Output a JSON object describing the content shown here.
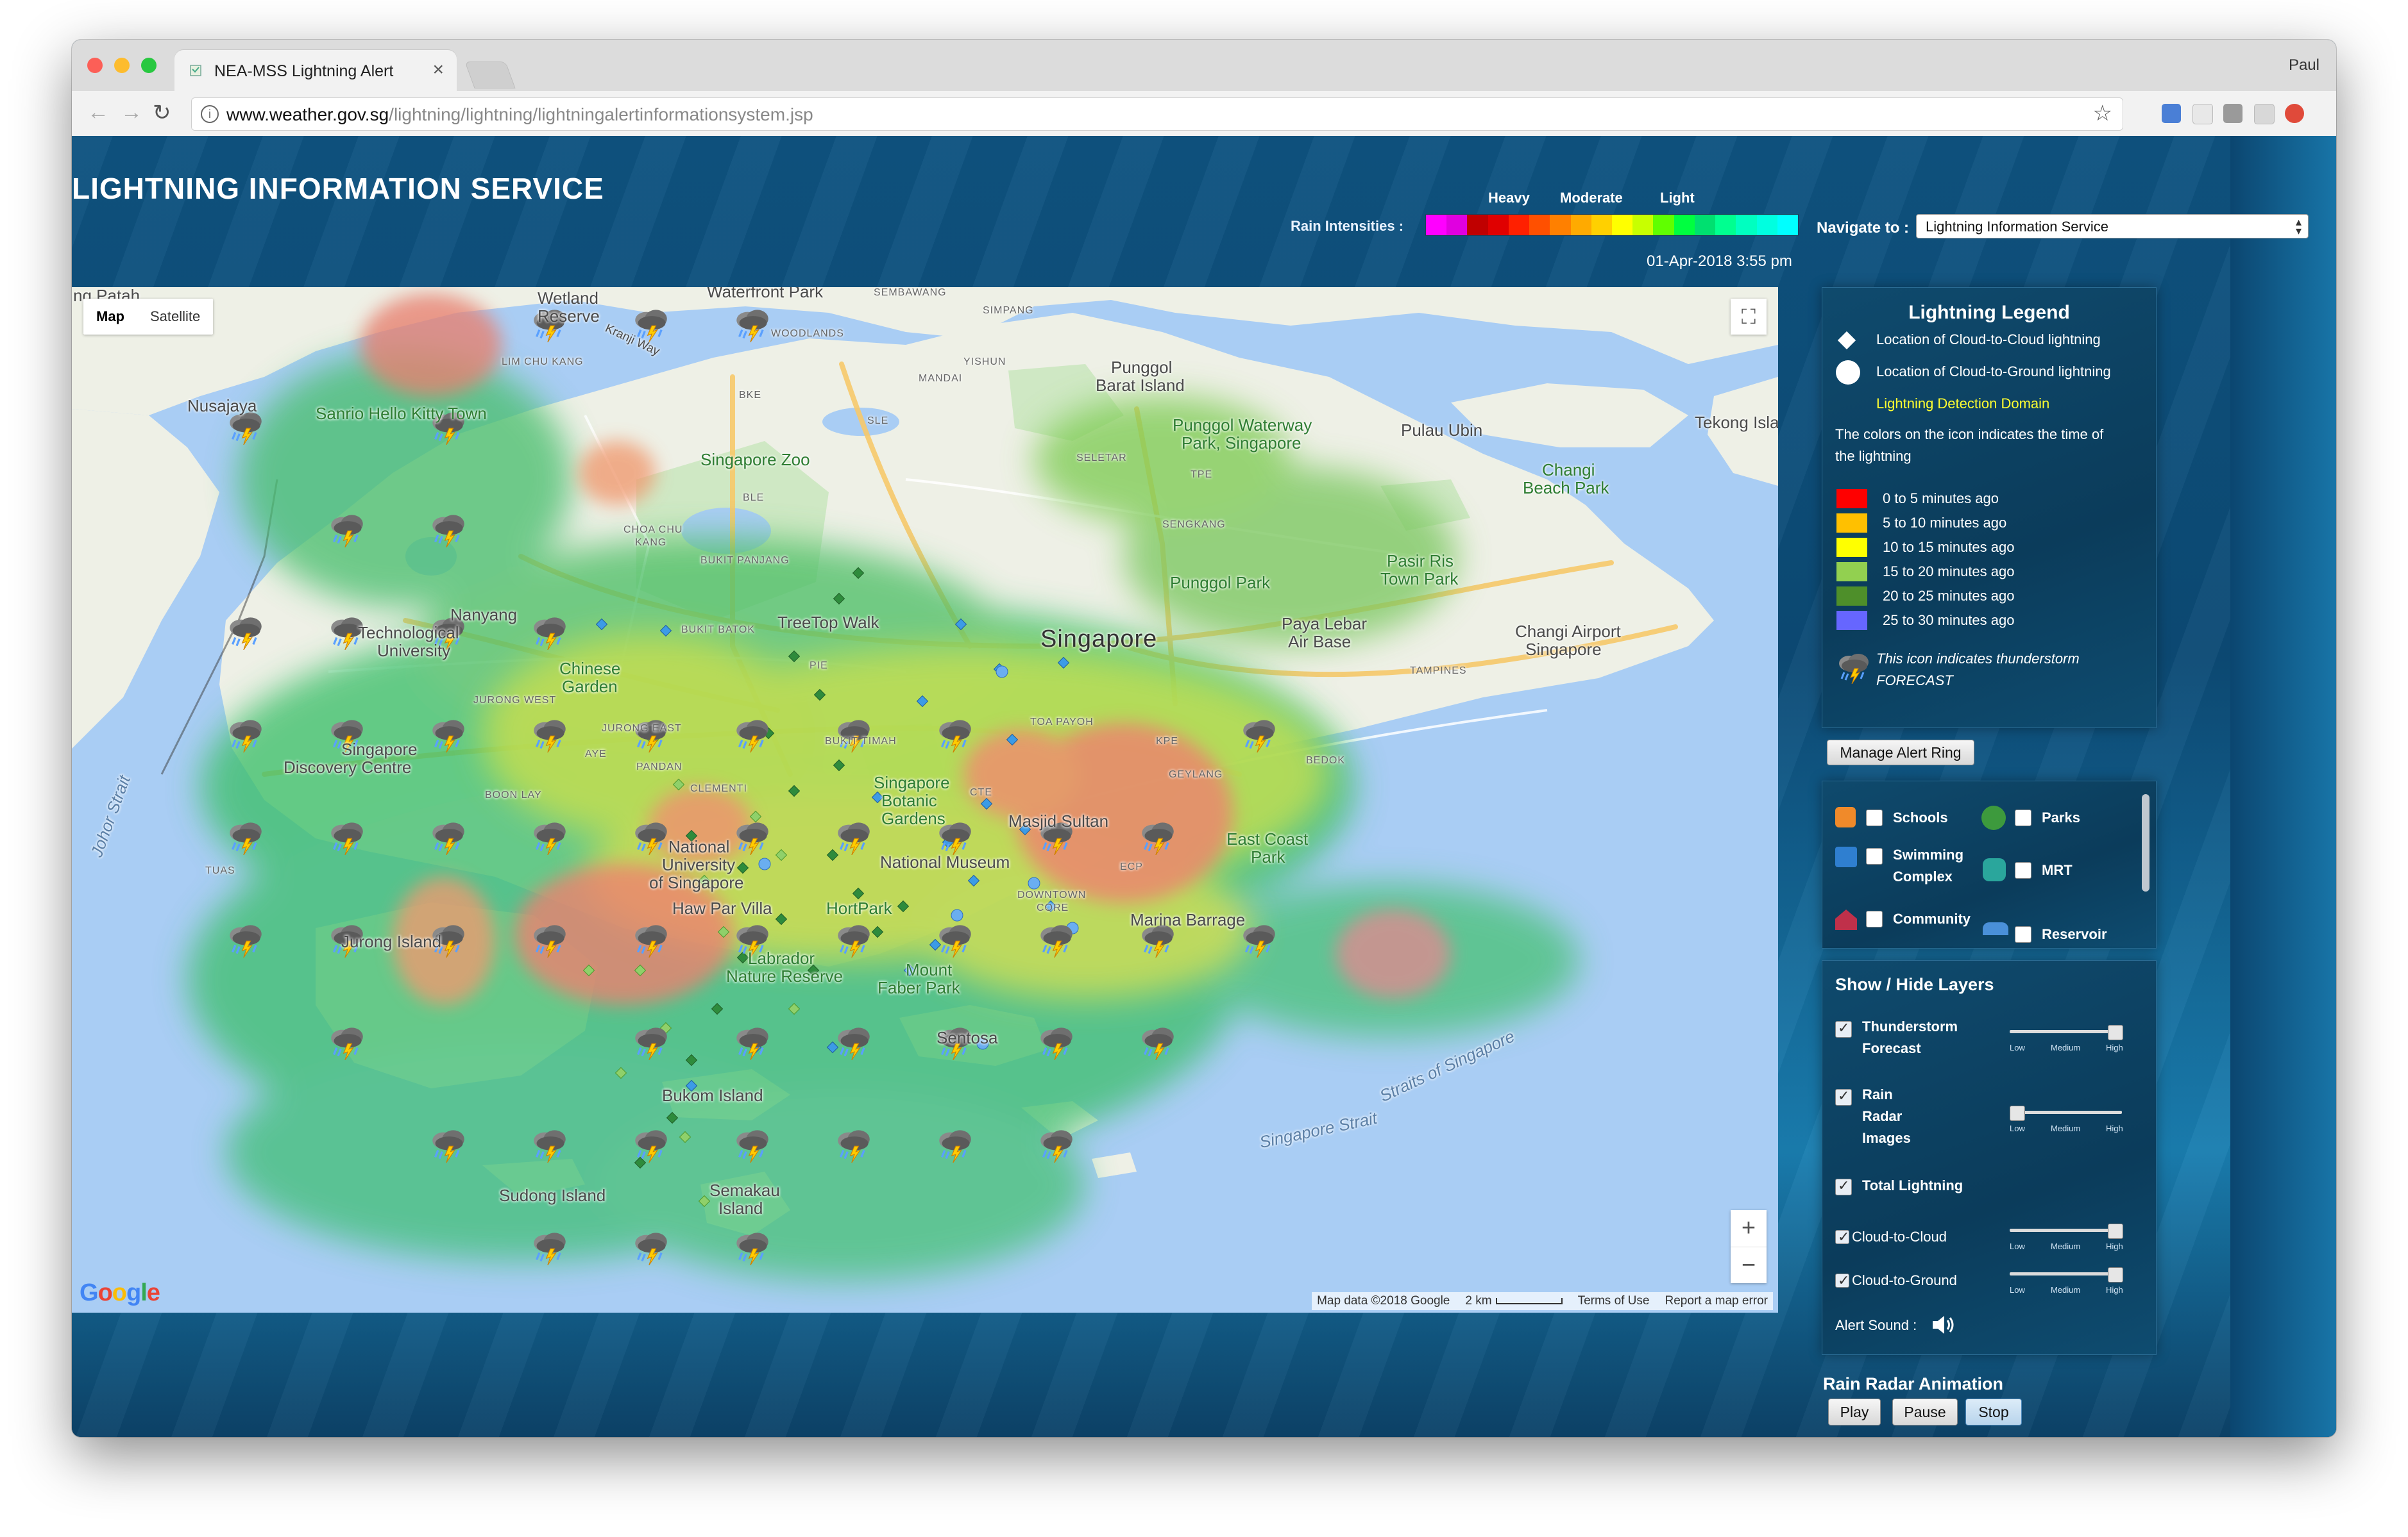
{
  "browser": {
    "tab_title": "NEA-MSS Lightning Alert",
    "tab_close": "×",
    "profile": "Paul",
    "url_host": "www.weather.gov.sg",
    "url_path": "/lightning/lightning/lightningalertinformationsystem.jsp"
  },
  "header": {
    "site_title": "LIGHTNING INFORMATION SERVICE",
    "rain_intensities_label": "Rain Intensities :",
    "intensity_heavy": "Heavy",
    "intensity_moderate": "Moderate",
    "intensity_light": "Light",
    "rain_colors": [
      "#ff00ff",
      "#e000e0",
      "#c00000",
      "#e00000",
      "#ff2000",
      "#ff5000",
      "#ff8000",
      "#ffaa00",
      "#ffd000",
      "#ffff00",
      "#c8ff00",
      "#60ff00",
      "#00ff40",
      "#00e070",
      "#00ff90",
      "#00ffc0",
      "#00ffe0",
      "#00ffff"
    ],
    "navigate_label": "Navigate to :",
    "navigate_selected": "Lightning Information Service",
    "datetime": "01-Apr-2018  3:55 pm"
  },
  "map": {
    "type_map": "Map",
    "type_satellite": "Satellite",
    "zoom_in": "+",
    "zoom_out": "−",
    "attribution": "Map data ©2018 Google",
    "scale": "2 km",
    "terms": "Terms of Use",
    "report": "Report a map error",
    "google": "Google",
    "labels": {
      "singapore": "Singapore",
      "nusajaya": "Nusajaya",
      "wetland": "Wetland",
      "reserve": "Reserve",
      "waterfront_park": "Waterfront Park",
      "kranji_way": "Kranji Way",
      "sembawang": "SEMBAWANG",
      "simpang": "SIMPANG",
      "woodlands": "WOODLANDS",
      "lim_chu_kang": "LIM CHU KANG",
      "yishun": "YISHUN",
      "mandai": "MANDAI",
      "punggol": "Punggol",
      "barat_island": "Barat Island",
      "sanrio": "Sanrio Hello Kitty Town",
      "singapore_zoo": "Singapore Zoo",
      "punggol_waterway": "Punggol Waterway",
      "park_singapore": "Park, Singapore",
      "pulau_ubin": "Pulau Ubin",
      "tekong": "Tekong Isla",
      "changi": "Changi",
      "beach_park": "Beach Park",
      "seletar": "SELETAR",
      "choa_chu": "CHOA CHU",
      "kang": "KANG",
      "bukit_panjang": "BUKIT PANJANG",
      "sengkang": "SENGKANG",
      "pasir_ris": "Pasir Ris",
      "town_park": "Town Park",
      "nanyang": "Nanyang",
      "technological": "Technological",
      "university": "University",
      "bukit_batok": "BUKIT BATOK",
      "treetop_walk": "TreeTop Walk",
      "punggol_park": "Punggol Park",
      "paya_lebar": "Paya Lebar",
      "air_base": "Air Base",
      "changi_airport": "Changi Airport",
      "changi_airport_2": "Singapore",
      "chinese": "Chinese",
      "garden": "Garden",
      "jurong_east": "JURONG EAST",
      "jurong_west": "JURONG WEST",
      "toa_payoh": "TOA PAYOH",
      "tampines": "TAMPINES",
      "singapore_discovery": "Singapore",
      "discovery_centre": "Discovery Centre",
      "bukit_timah": "BUKIT TIMAH",
      "geylang": "GEYLANG",
      "bedok": "BEDOK",
      "boon_lay": "BOON LAY",
      "pandan": "PANDAN",
      "clementi": "CLEMENTI",
      "botanic": "Singapore",
      "botanic_2": "Botanic",
      "botanic_3": "Gardens",
      "sultan": "Masjid Sultan",
      "east_coast": "East Coast",
      "east_coast_park": "Park",
      "tuas": "TUAS",
      "nus": "National",
      "nus_2": "University",
      "nus_3": "of Singapore",
      "national_museum": "National Museum",
      "downtown": "DOWNTOWN",
      "core": "CORE",
      "haw_par": "Haw Par Villa",
      "hort_park": "HortPark",
      "marina": "Marina Barrage",
      "jurong_island": "Jurong Island",
      "labrador": "Labrador",
      "nature_reserve": "Nature Reserve",
      "mount_faber": "Mount",
      "faber_park": "Faber Park",
      "sentosa": "Sentosa",
      "bukom": "Bukom Island",
      "singapore_strait": "Singapore Strait",
      "straits_of_singapore": "Straits of Singapore",
      "sudong": "Sudong Island",
      "semakau": "Semakau",
      "semakau_2": "Island",
      "johor_strait": "Johor Strait",
      "ecp": "ECP",
      "pie": "PIE",
      "aye": "AYE",
      "ble": "BLE",
      "bke": "BKE",
      "sle": "SLE",
      "tpe": "TPE",
      "kpe": "KPE",
      "cte": "CTE"
    }
  },
  "legend": {
    "title": "Lightning Legend",
    "cc": "Location of Cloud-to-Cloud lightning",
    "cg": "Location of Cloud-to-Ground lightning",
    "domain": "Lightning Detection Domain",
    "note1": "The colors on the icon indicates the time of",
    "note2": "the lightning",
    "times": [
      {
        "label": "0 to 5 minutes ago",
        "color": "#ff0000"
      },
      {
        "label": "5 to 10 minutes ago",
        "color": "#ffc000"
      },
      {
        "label": "10 to 15 minutes ago",
        "color": "#ffff00"
      },
      {
        "label": "15 to 20 minutes ago",
        "color": "#92d050"
      },
      {
        "label": "20 to 25 minutes ago",
        "color": "#4e8f2a"
      },
      {
        "label": "25 to 30 minutes ago",
        "color": "#6666ff"
      }
    ],
    "forecast1": "This icon indicates thunderstorm",
    "forecast2": "FORECAST"
  },
  "alert_ring_button": "Manage Alert Ring",
  "places": {
    "schools": "Schools",
    "parks": "Parks",
    "swimming1": "Swimming",
    "swimming2": "Complex",
    "mrt": "MRT",
    "community": "Community",
    "reservoir": "Reservoir"
  },
  "layers": {
    "title": "Show / Hide Layers",
    "thunder1": "Thunderstorm",
    "thunder2": "Forecast",
    "rain1": "Rain",
    "rain2": "Radar",
    "rain3": "Images",
    "total": "Total Lightning",
    "cc": "Cloud-to-Cloud",
    "cg": "Cloud-to-Ground",
    "alert_sound": "Alert Sound :",
    "low": "Low",
    "medium": "Medium",
    "high": "High",
    "thunder_level": 1.0,
    "rain_level": 0.0,
    "cc_level": 1.0,
    "cg_level": 1.0
  },
  "animation": {
    "title": "Rain Radar Animation",
    "play": "Play",
    "pause": "Pause",
    "stop": "Stop"
  }
}
